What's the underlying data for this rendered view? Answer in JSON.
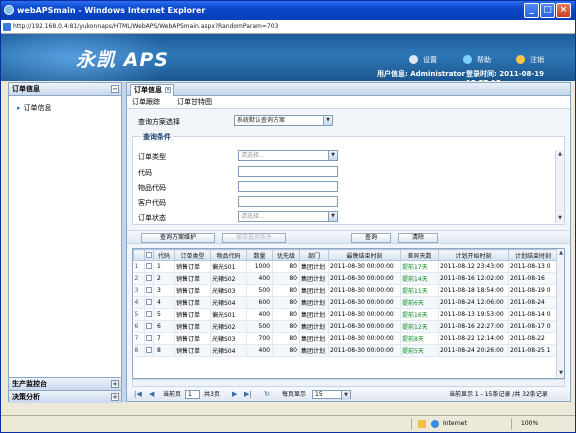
{
  "window": {
    "title": "webAPSmain - Windows Internet Explorer",
    "url": "http://192.168.0.4:81/yukonnaps/HTML/WebAPS/WebAPSmain.aspx?RandomParam=703",
    "min": "_",
    "max": "□",
    "close": "×"
  },
  "header": {
    "logo": "永凯 APS",
    "links": [
      {
        "label": "设置"
      },
      {
        "label": "帮助"
      },
      {
        "label": "注销"
      }
    ],
    "user_info": "用户信息: Administrator",
    "login_time": "登录时间: 2011-08-19 15:57:15"
  },
  "sidebar": {
    "title": "订单信息",
    "items": [
      {
        "label": "订单信息"
      }
    ],
    "bottom_panels": [
      {
        "label": "生产监控台"
      },
      {
        "label": "决策分析"
      }
    ]
  },
  "main": {
    "tab": "订单信息",
    "subnav": [
      "订单跟踪",
      "订单甘特图"
    ],
    "query_scheme_label": "查询方案选择",
    "query_scheme_value": "系统默认查询方案",
    "conditions_title": "查询条件",
    "fields": [
      {
        "label": "订单类型",
        "placeholder": "请选择...",
        "dropdown": true
      },
      {
        "label": "代码",
        "placeholder": "",
        "dropdown": false
      },
      {
        "label": "物品代码",
        "placeholder": "",
        "dropdown": false
      },
      {
        "label": "客户代码",
        "placeholder": "",
        "dropdown": false
      },
      {
        "label": "订单状态",
        "placeholder": "请选择...",
        "dropdown": true
      }
    ],
    "buttons": {
      "maintain": "查询方案维护",
      "save": "保存查询条件",
      "query": "查询",
      "clear": "清除"
    }
  },
  "table": {
    "columns": [
      "",
      "",
      "代码",
      "订单类型",
      "物品代码",
      "数量",
      "优先级",
      "部门",
      "最晚结束时刻",
      "差异天数",
      "计划开始时刻",
      "计划结束时刻"
    ],
    "rows": [
      [
        "1",
        "1",
        "销售订单",
        "偏光S01",
        "1000",
        "80",
        "集团计划",
        "2011-08-30 00:00:00",
        "提前17天",
        "2011-08-12 23:43:00",
        "2011-08-13 0"
      ],
      [
        "2",
        "2",
        "销售订单",
        "光辕S02",
        "400",
        "80",
        "集团计划",
        "2011-08-30 00:00:00",
        "提前14天",
        "2011-08-16 12:02:00",
        "2011-08-16"
      ],
      [
        "3",
        "3",
        "销售订单",
        "光辕S03",
        "500",
        "80",
        "集团计划",
        "2011-08-30 00:00:00",
        "提前11天",
        "2011-08-18 18:54:00",
        "2011-08-19 0"
      ],
      [
        "4",
        "4",
        "销售订单",
        "光辕S04",
        "600",
        "80",
        "集团计划",
        "2011-08-30 00:00:00",
        "提前6天",
        "2011-08-24 12:06:00",
        "2011-08-24"
      ],
      [
        "5",
        "5",
        "销售订单",
        "偏光S01",
        "400",
        "80",
        "集团计划",
        "2011-08-30 00:00:00",
        "提前16天",
        "2011-08-13 19:53:00",
        "2011-08-14 0"
      ],
      [
        "6",
        "6",
        "销售订单",
        "光辕S02",
        "500",
        "80",
        "集团计划",
        "2011-08-30 00:00:00",
        "提前12天",
        "2011-08-16 22:27:00",
        "2011-08-17 0"
      ],
      [
        "7",
        "7",
        "销售订单",
        "光辕S03",
        "700",
        "80",
        "集团计划",
        "2011-08-30 00:00:00",
        "提前8天",
        "2011-08-22 12:14:00",
        "2011-08-22"
      ],
      [
        "8",
        "8",
        "销售订单",
        "光辕S04",
        "400",
        "80",
        "集团计划",
        "2011-08-30 00:00:00",
        "提前5天",
        "2011-08-24 20:26:00",
        "2011-08-25 1"
      ]
    ]
  },
  "pager": {
    "page_label": "当前页",
    "page_value": "1",
    "total_pages": "共3页",
    "page_size_label": "每页显示",
    "page_size": "15",
    "display_info": "当前显示 1 - 15条记录 /共 32条记录"
  },
  "statusbar": {
    "zone": "Internet",
    "zoom": "100%"
  }
}
